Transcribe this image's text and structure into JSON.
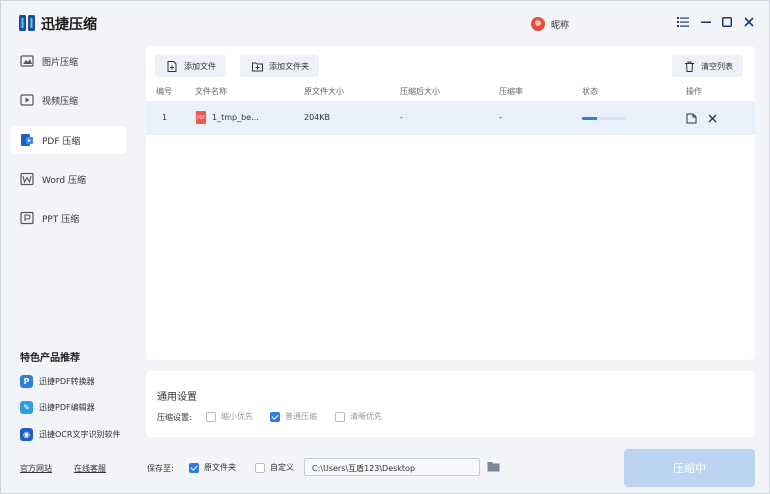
{
  "app": {
    "title": "迅捷压缩",
    "username": "昵称"
  },
  "sidebar": {
    "items": [
      {
        "label": "图片压缩"
      },
      {
        "label": "视频压缩"
      },
      {
        "label": "PDF 压缩"
      },
      {
        "label": "Word 压缩"
      },
      {
        "label": "PPT 压缩"
      }
    ],
    "featured_title": "特色产品推荐",
    "products": [
      {
        "label": "迅捷PDF转换器"
      },
      {
        "label": "迅捷PDF编辑器"
      },
      {
        "label": "迅捷OCR文字识别软件"
      }
    ],
    "links": {
      "official": "官方网站",
      "support": "在线客服"
    }
  },
  "toolbar": {
    "add_file": "添加文件",
    "add_folder": "添加文件夹",
    "clear_list": "清空列表"
  },
  "table": {
    "headers": [
      "编号",
      "文件名称",
      "原文件大小",
      "压缩后大小",
      "压缩率",
      "状态",
      "操作"
    ],
    "rows": [
      {
        "index": "1",
        "name": "1_tmp_be...",
        "size": "204KB",
        "compressed": "-",
        "ratio": "-",
        "progress": 0.35
      }
    ]
  },
  "settings": {
    "title": "通用设置",
    "label": "压缩设置:",
    "options": [
      {
        "label": "缩小优先",
        "checked": false
      },
      {
        "label": "普通压缩",
        "checked": true
      },
      {
        "label": "清晰优先",
        "checked": false
      }
    ]
  },
  "bottom": {
    "save_label": "保存至:",
    "opt_original": "原文件夹",
    "opt_original_checked": true,
    "opt_custom": "自定义",
    "opt_custom_checked": false,
    "path": "C:\\Users\\互盾123\\Desktop",
    "compress_button": "压缩中"
  },
  "colors": {
    "accent": "#2f7de1",
    "button_disabled": "#bcd3f2",
    "row_highlight": "#e8f0fb"
  }
}
